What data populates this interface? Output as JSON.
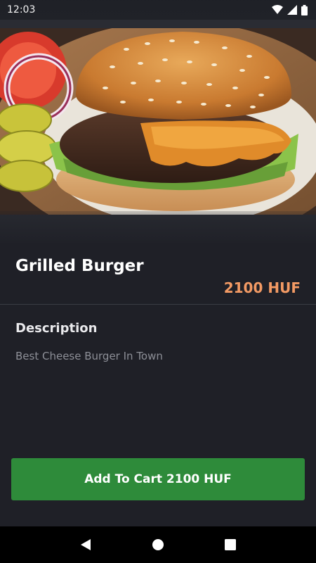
{
  "status_bar": {
    "time": "12:03",
    "icons": [
      "wifi-icon",
      "signal-icon",
      "battery-icon"
    ]
  },
  "product": {
    "title": "Grilled Burger",
    "price": "2100 HUF",
    "description_heading": "Description",
    "description": "Best Cheese Burger In Town"
  },
  "cart": {
    "button_label": "Add To Cart 2100 HUF"
  },
  "navigation": {
    "icons": [
      "back-icon",
      "home-icon",
      "recents-icon"
    ]
  },
  "colors": {
    "background": "#1f2027",
    "price": "#f39a64",
    "button": "#2e8b3a"
  }
}
